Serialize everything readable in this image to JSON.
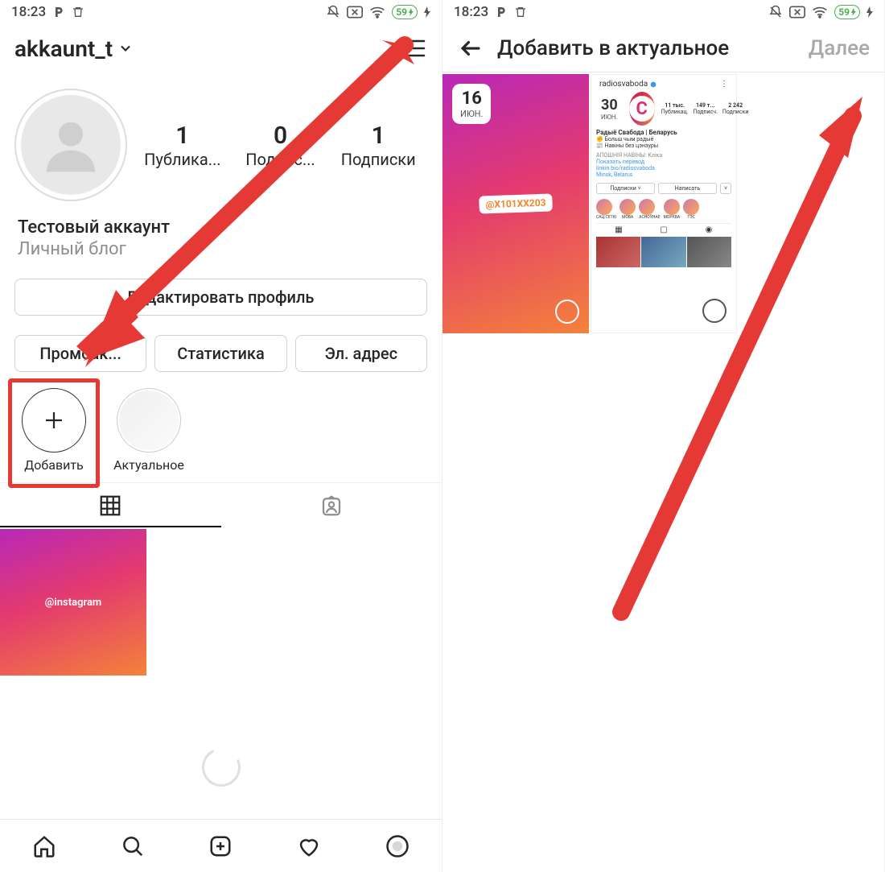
{
  "status": {
    "time": "18:23",
    "battery": "59"
  },
  "left": {
    "username": "akkaunt_t",
    "stats": {
      "posts_num": "1",
      "posts_lbl": "Публика...",
      "followers_num": "0",
      "followers_lbl": "Подпис...",
      "following_num": "1",
      "following_lbl": "Подписки"
    },
    "bio": {
      "name": "Тестовый аккаунт",
      "category": "Личный блог"
    },
    "buttons": {
      "edit": "Редактировать профиль",
      "promo": "Промоак...",
      "stats": "Статистика",
      "email": "Эл. адрес"
    },
    "highlights": {
      "add": "Добавить",
      "actual": "Актуальное"
    },
    "post_tag": "@instagram"
  },
  "right": {
    "header": {
      "title": "Добавить в актуальное",
      "next": "Далее"
    },
    "tile1": {
      "day": "16",
      "month": "июн.",
      "mention": "@X101XX203"
    },
    "tile2": {
      "day": "30",
      "month": "ИЮН.",
      "handle": "radiosvaboda",
      "s1n": "11 тыс.",
      "s1l": "Публикац.",
      "s2n": "149 т...",
      "s2l": "Подписч.",
      "s3n": "2 242",
      "s3l": "Подписки",
      "name": "Радыё Свабода | Беларусь",
      "line1": "✊ Больш чым радыё",
      "line2": "📰 Навіны без цэнзуры",
      "line3": "АПОШНІЯ НАВІНЫ: Кліка",
      "line4": "Показать перевод",
      "line5": "linkin.bio/radiosvaboda",
      "line6": "Minsk, Belarus",
      "btn1": "Подписки",
      "btn2": "Написать",
      "h1": "САЦ.СЕТКІ",
      "h2": "МОВА",
      "h3": "АСНОЎНАЕ",
      "h4": "МОРКВА",
      "h5": "ТЭС"
    }
  }
}
